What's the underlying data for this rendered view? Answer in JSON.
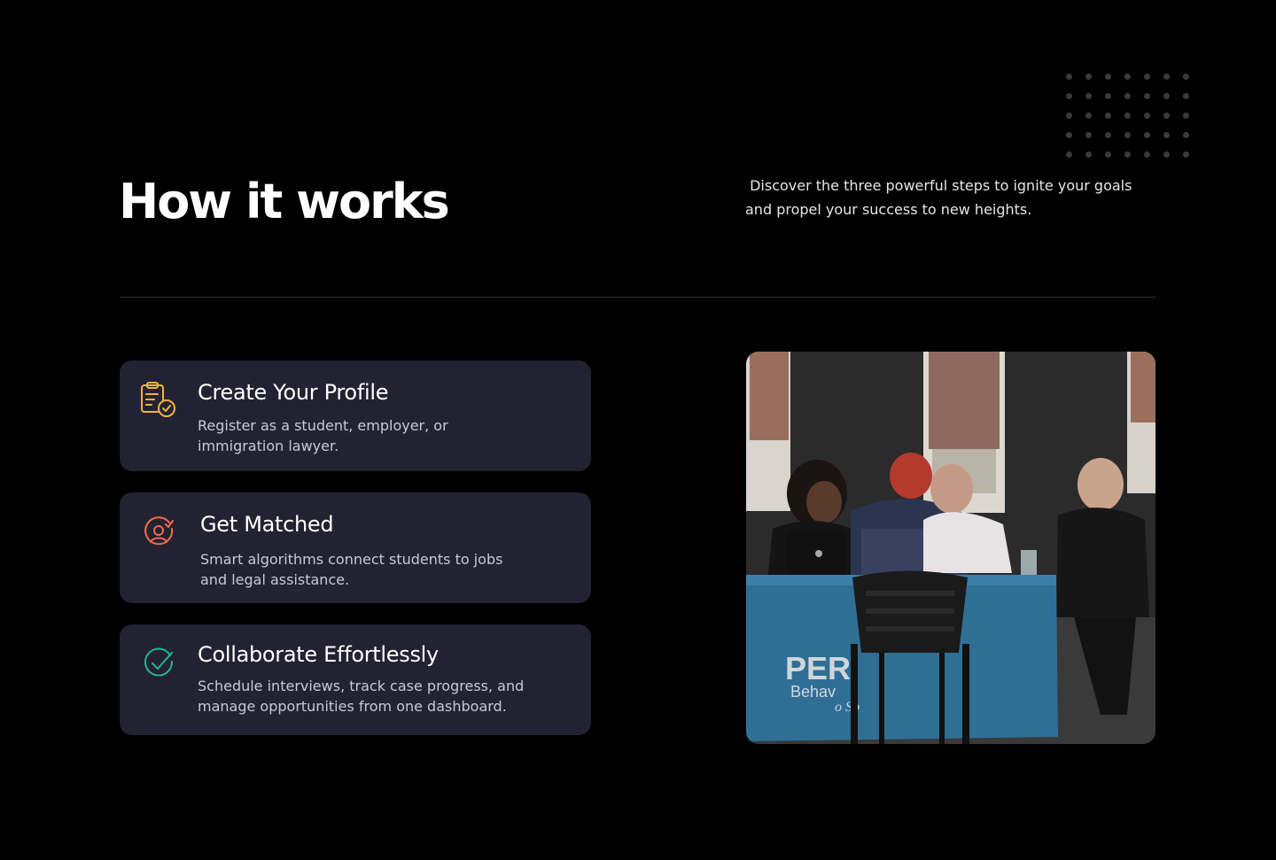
{
  "header": {
    "title": "How it works",
    "subtitle": " Discover the three powerful steps to ignite your goals\nand propel your success to new heights."
  },
  "steps": [
    {
      "title": "Create Your Profile",
      "description": "Register as a student, employer, or\nimmigration lawyer.",
      "icon": "clipboard-check-icon",
      "icon_color": "#f2b23a"
    },
    {
      "title": "Get Matched",
      "description": "Smart algorithms connect students to jobs\nand legal assistance.",
      "icon": "user-target-icon",
      "icon_color": "#f06a4a"
    },
    {
      "title": "Collaborate Effortlessly",
      "description": "Schedule interviews, track case progress, and\nmanage opportunities from one dashboard.",
      "icon": "check-circle-icon",
      "icon_color": "#1fb89a"
    }
  ],
  "photo": {
    "banner_text_line1": "PER",
    "banner_text_line2": "Behav",
    "banner_text_line3": "o Sp"
  },
  "colors": {
    "background": "#000000",
    "card": "#232233",
    "dots": "#3a3a3a"
  }
}
